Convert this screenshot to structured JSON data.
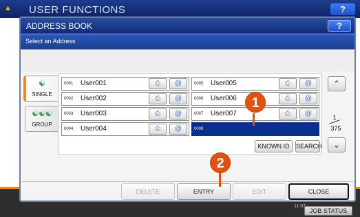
{
  "background": {
    "title": "USER FUNCTIONS",
    "help": "?",
    "time": "11:07",
    "job_status": "JOB STATUS"
  },
  "dialog": {
    "title": "ADDRESS BOOK",
    "help": "?",
    "subtitle": "Select an Address"
  },
  "tabs": [
    {
      "label": "SINGLE",
      "icon": "person-icon",
      "selected": true
    },
    {
      "label": "GROUP",
      "icon": "people-group-icon",
      "selected": false
    }
  ],
  "entries": [
    {
      "no": "0001",
      "name": "User001"
    },
    {
      "no": "0002",
      "name": "User002"
    },
    {
      "no": "0003",
      "name": "User003"
    },
    {
      "no": "0004",
      "name": "User004"
    },
    {
      "no": "0005",
      "name": "User005"
    },
    {
      "no": "0006",
      "name": "User006"
    },
    {
      "no": "0007",
      "name": "User007"
    },
    {
      "no": "0008",
      "name": "",
      "selected": true
    }
  ],
  "pagination": {
    "current": "1",
    "total": "375"
  },
  "buttons": {
    "known_id": "KNOWN ID",
    "search": "SEARCH",
    "delete": "DELETE",
    "entry": "ENTRY",
    "edit": "EDIT",
    "close": "CLOSE"
  },
  "callouts": {
    "one": "1",
    "two": "2"
  },
  "colors": {
    "accent": "#e2520e",
    "title_blue": "#1a3f93",
    "selection": "#0b2f8f",
    "tab_marker": "#f08a14"
  }
}
